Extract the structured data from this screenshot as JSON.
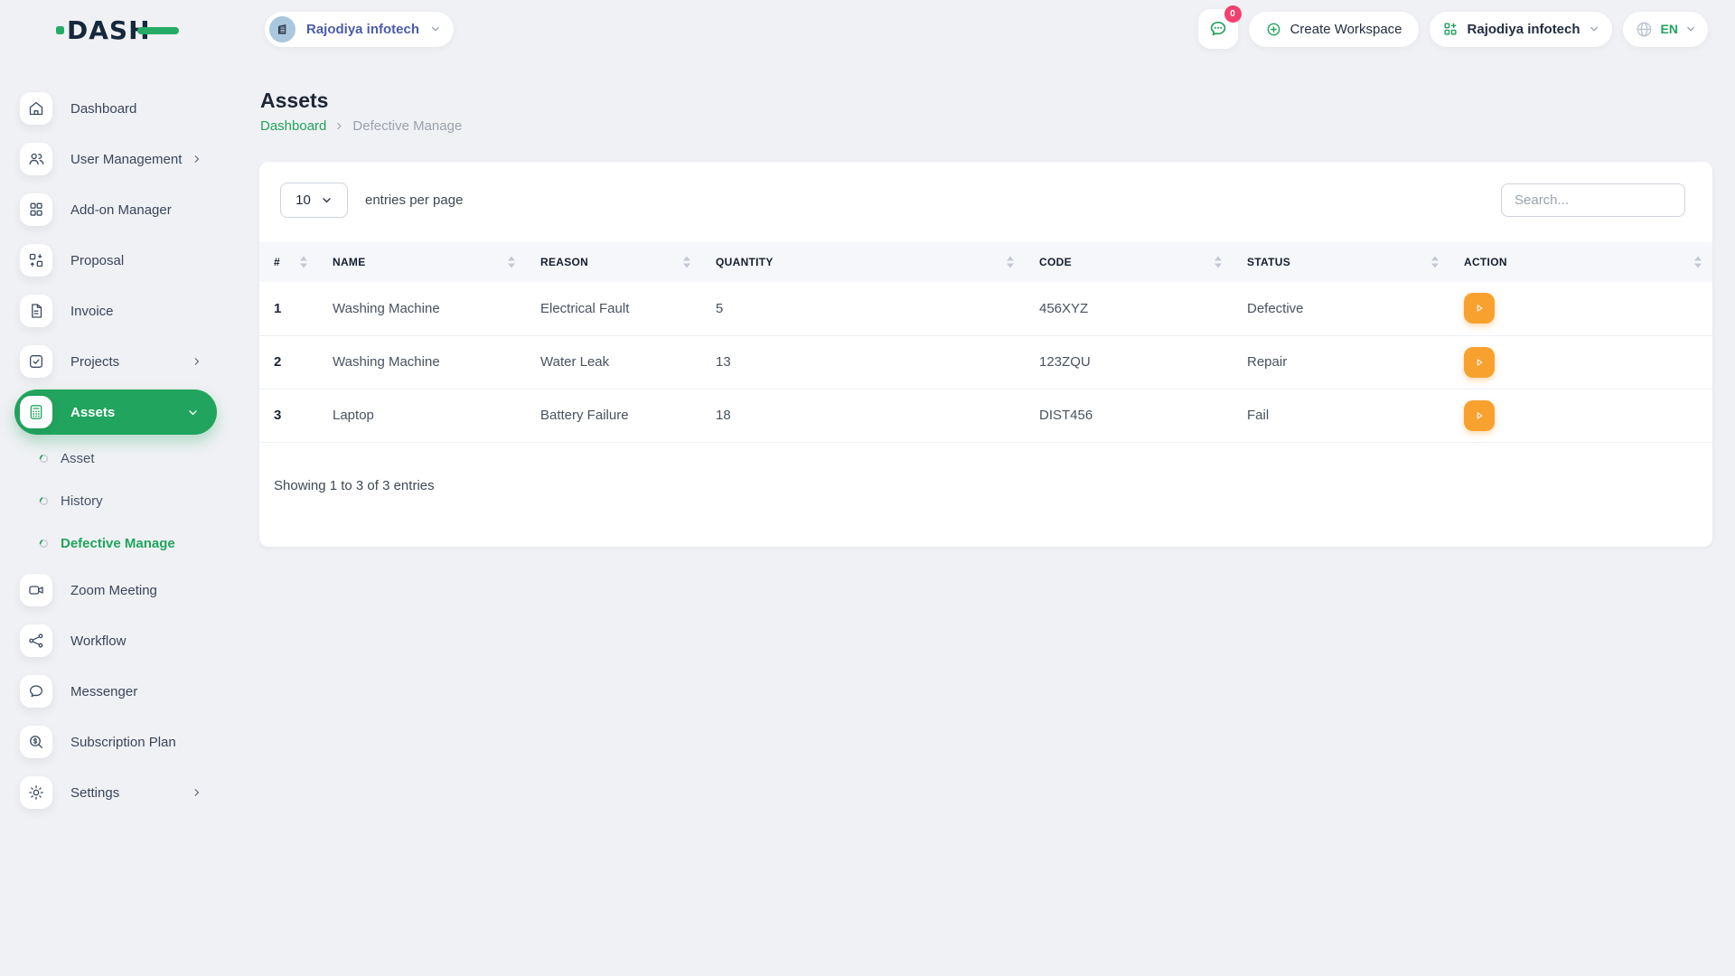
{
  "brand": {
    "logo_text": "DASH"
  },
  "topbar": {
    "workspace": {
      "label": "Rajodiya infotech"
    },
    "notification_badge": "0",
    "create_workspace_label": "Create Workspace",
    "company": {
      "label": "Rajodiya infotech"
    },
    "language": {
      "label": "EN"
    }
  },
  "sidebar": {
    "items": [
      {
        "label": "Dashboard"
      },
      {
        "label": "User Management"
      },
      {
        "label": "Add-on Manager"
      },
      {
        "label": "Proposal"
      },
      {
        "label": "Invoice"
      },
      {
        "label": "Projects"
      },
      {
        "label": "Assets"
      },
      {
        "label": "Zoom Meeting"
      },
      {
        "label": "Workflow"
      },
      {
        "label": "Messenger"
      },
      {
        "label": "Subscription Plan"
      },
      {
        "label": "Settings"
      }
    ],
    "assets_submenu": [
      {
        "label": "Asset"
      },
      {
        "label": "History"
      },
      {
        "label": "Defective Manage"
      }
    ]
  },
  "page": {
    "title": "Assets",
    "breadcrumb_root": "Dashboard",
    "breadcrumb_current": "Defective Manage"
  },
  "table_card": {
    "entries_value": "10",
    "entries_label": "entries per page",
    "search_placeholder": "Search...",
    "columns": [
      "#",
      "NAME",
      "REASON",
      "QUANTITY",
      "CODE",
      "STATUS",
      "ACTION"
    ],
    "rows": [
      {
        "num": "1",
        "name": "Washing Machine",
        "reason": "Electrical Fault",
        "quantity": "5",
        "code": "456XYZ",
        "status": "Defective"
      },
      {
        "num": "2",
        "name": "Washing Machine",
        "reason": "Water Leak",
        "quantity": "13",
        "code": "123ZQU",
        "status": "Repair"
      },
      {
        "num": "3",
        "name": "Laptop",
        "reason": "Battery Failure",
        "quantity": "18",
        "code": "DIST456",
        "status": "Fail"
      }
    ],
    "footer": "Showing 1 to 3 of 3 entries"
  },
  "colors": {
    "accent_green": "#21a45d",
    "action_orange": "#f8a12f",
    "badge_pink": "#f2416f",
    "workspace_text": "#4b5cab"
  }
}
